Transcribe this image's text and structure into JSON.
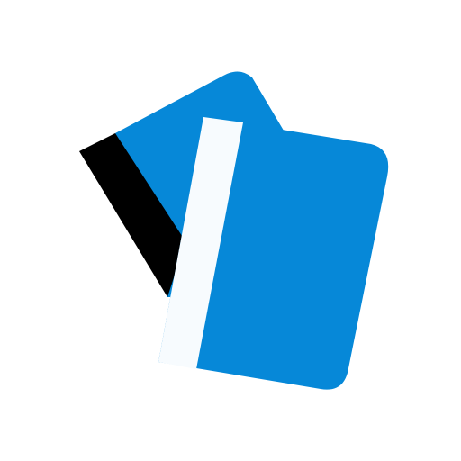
{
  "icon": {
    "name": "cards-icon",
    "colors": {
      "background": "#ffffff",
      "card": "#0688d8",
      "magnetic_stripe": "#000000",
      "stripe_highlight": "#f7fbfe"
    }
  }
}
